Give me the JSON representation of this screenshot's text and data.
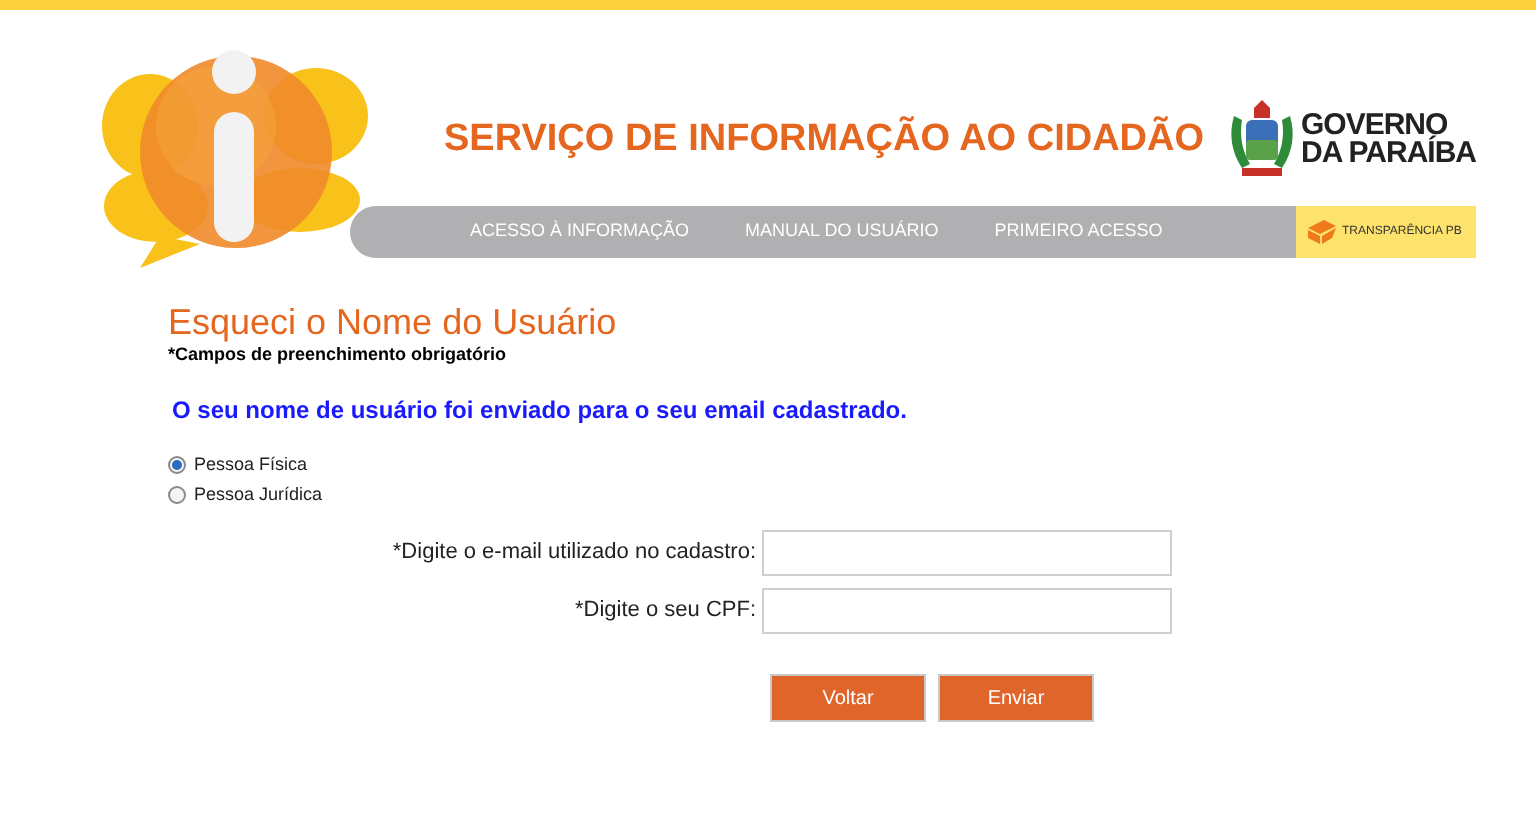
{
  "header": {
    "title": "SERVIÇO DE INFORMAÇÃO AO CIDADÃO",
    "government": [
      "GOVERNO",
      "DA PARAÍBA"
    ],
    "nav": [
      "ACESSO À INFORMAÇÃO",
      "MANUAL DO USUÁRIO",
      "PRIMEIRO ACESSO"
    ],
    "transparency": "TRANSPARÊNCIA PB"
  },
  "page": {
    "heading": "Esqueci o Nome do Usuário",
    "required_note": "*Campos de preenchimento obrigatório",
    "message": "O seu nome de usuário foi enviado para o seu email cadastrado.",
    "person_types": [
      {
        "label": "Pessoa Física",
        "selected": true
      },
      {
        "label": "Pessoa Jurídica",
        "selected": false
      }
    ],
    "fields": [
      {
        "label": "*Digite o e-mail utilizado no cadastro:"
      },
      {
        "label": "*Digite o seu CPF:"
      }
    ],
    "buttons": [
      "Voltar",
      "Enviar"
    ]
  }
}
